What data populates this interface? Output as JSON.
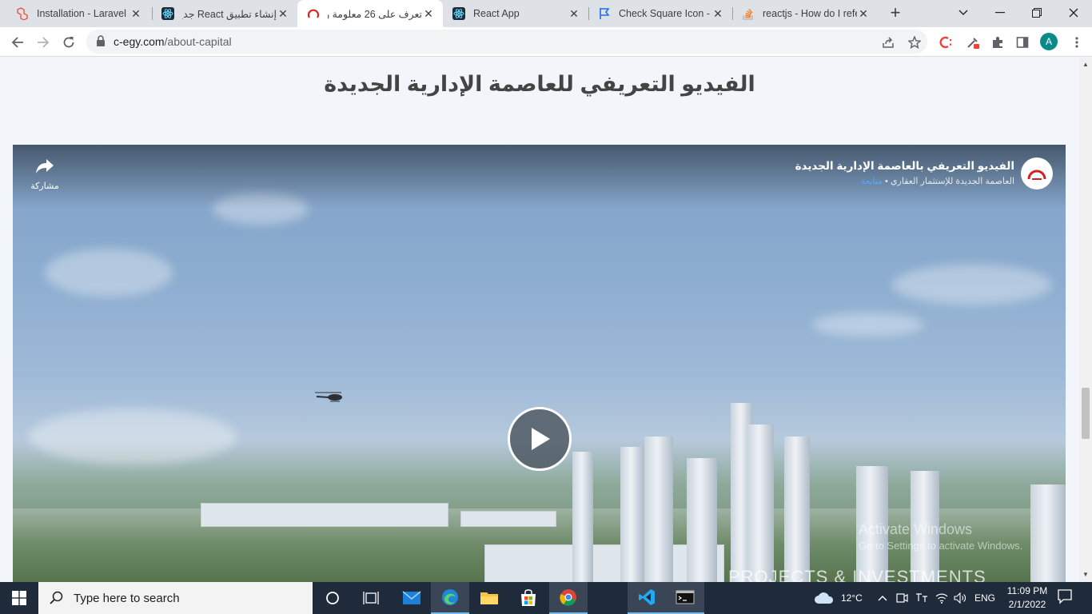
{
  "browser": {
    "tabs": [
      {
        "title": "Installation - Laravel -",
        "icon": "laravel-icon",
        "color": "#f05340"
      },
      {
        "title": "إنشاء تطبيق React جديد",
        "icon": "react-icon",
        "color": "#1e2a3a"
      },
      {
        "title": "تعرف على 26 معلومة ر",
        "icon": "c-egy-logo-icon",
        "color": "#e02020"
      },
      {
        "title": "React App",
        "icon": "react-icon",
        "color": "#1e2a3a"
      },
      {
        "title": "Check Square Icon - R",
        "icon": "flag-icon",
        "color": "#1a73e8"
      },
      {
        "title": "reactjs - How do I refe",
        "icon": "stackoverflow-icon",
        "color": "#f48024"
      }
    ],
    "active_tab": 2,
    "url_host": "c-egy.com",
    "url_path": "/about-capital",
    "avatar_letter": "A"
  },
  "page": {
    "heading": "الفيديو التعريفي للعاصمة الإدارية الجديدة",
    "video": {
      "title": "الفيديو التعريفي بالعاصمة الإدارية الجديدة",
      "channel": "العاصمة الجديدة للإستثمار العقاري",
      "separator": "•",
      "subscribe_label": "متابعة",
      "share_label": "مشاركة",
      "watermark": "PROJECTS & INVESTMENTS"
    },
    "activate_windows": {
      "line1": "Activate Windows",
      "line2": "Go to Settings to activate Windows."
    }
  },
  "taskbar": {
    "search_placeholder": "Type here to search",
    "weather_temp": "12°C",
    "language": "ENG",
    "time": "11:09 PM",
    "date": "2/1/2022"
  }
}
